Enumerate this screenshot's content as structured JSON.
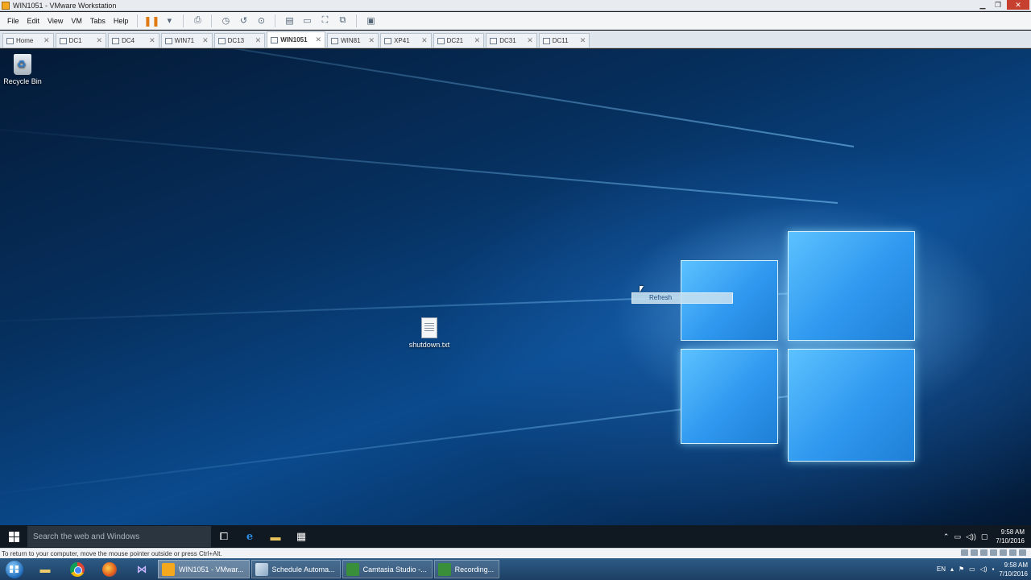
{
  "window": {
    "title": "WIN1051 - VMware Workstation"
  },
  "menu": [
    "File",
    "Edit",
    "View",
    "VM",
    "Tabs",
    "Help"
  ],
  "tabs": [
    {
      "label": "Home",
      "active": false
    },
    {
      "label": "DC1",
      "active": false
    },
    {
      "label": "DC4",
      "active": false
    },
    {
      "label": "WIN71",
      "active": false
    },
    {
      "label": "DC13",
      "active": false
    },
    {
      "label": "WIN1051",
      "active": true
    },
    {
      "label": "WIN81",
      "active": false
    },
    {
      "label": "XP41",
      "active": false
    },
    {
      "label": "DC21",
      "active": false
    },
    {
      "label": "DC31",
      "active": false
    },
    {
      "label": "DC11",
      "active": false
    }
  ],
  "desktop": {
    "icons": [
      {
        "label": "Recycle Bin",
        "icon": "recycle-bin-icon"
      },
      {
        "label": "shutdown.txt",
        "icon": "text-file-icon"
      }
    ],
    "context_menu": {
      "item": "Refresh"
    }
  },
  "guest_taskbar": {
    "search_placeholder": "Search the web and Windows",
    "tray": {
      "language": "",
      "time": "9:58 AM",
      "date": "7/10/2016"
    }
  },
  "status": {
    "message": "To return to your computer, move the mouse pointer outside or press Ctrl+Alt."
  },
  "host_taskbar": {
    "tasks": [
      {
        "label": "WIN1051 - VMwar...",
        "active": true
      },
      {
        "label": "Schedule Automa...",
        "active": false
      },
      {
        "label": "Camtasia Studio -...",
        "active": false
      },
      {
        "label": "Recording...",
        "active": false
      }
    ],
    "tray": {
      "language": "EN",
      "time": "9:58 AM",
      "date": "7/10/2016"
    }
  }
}
